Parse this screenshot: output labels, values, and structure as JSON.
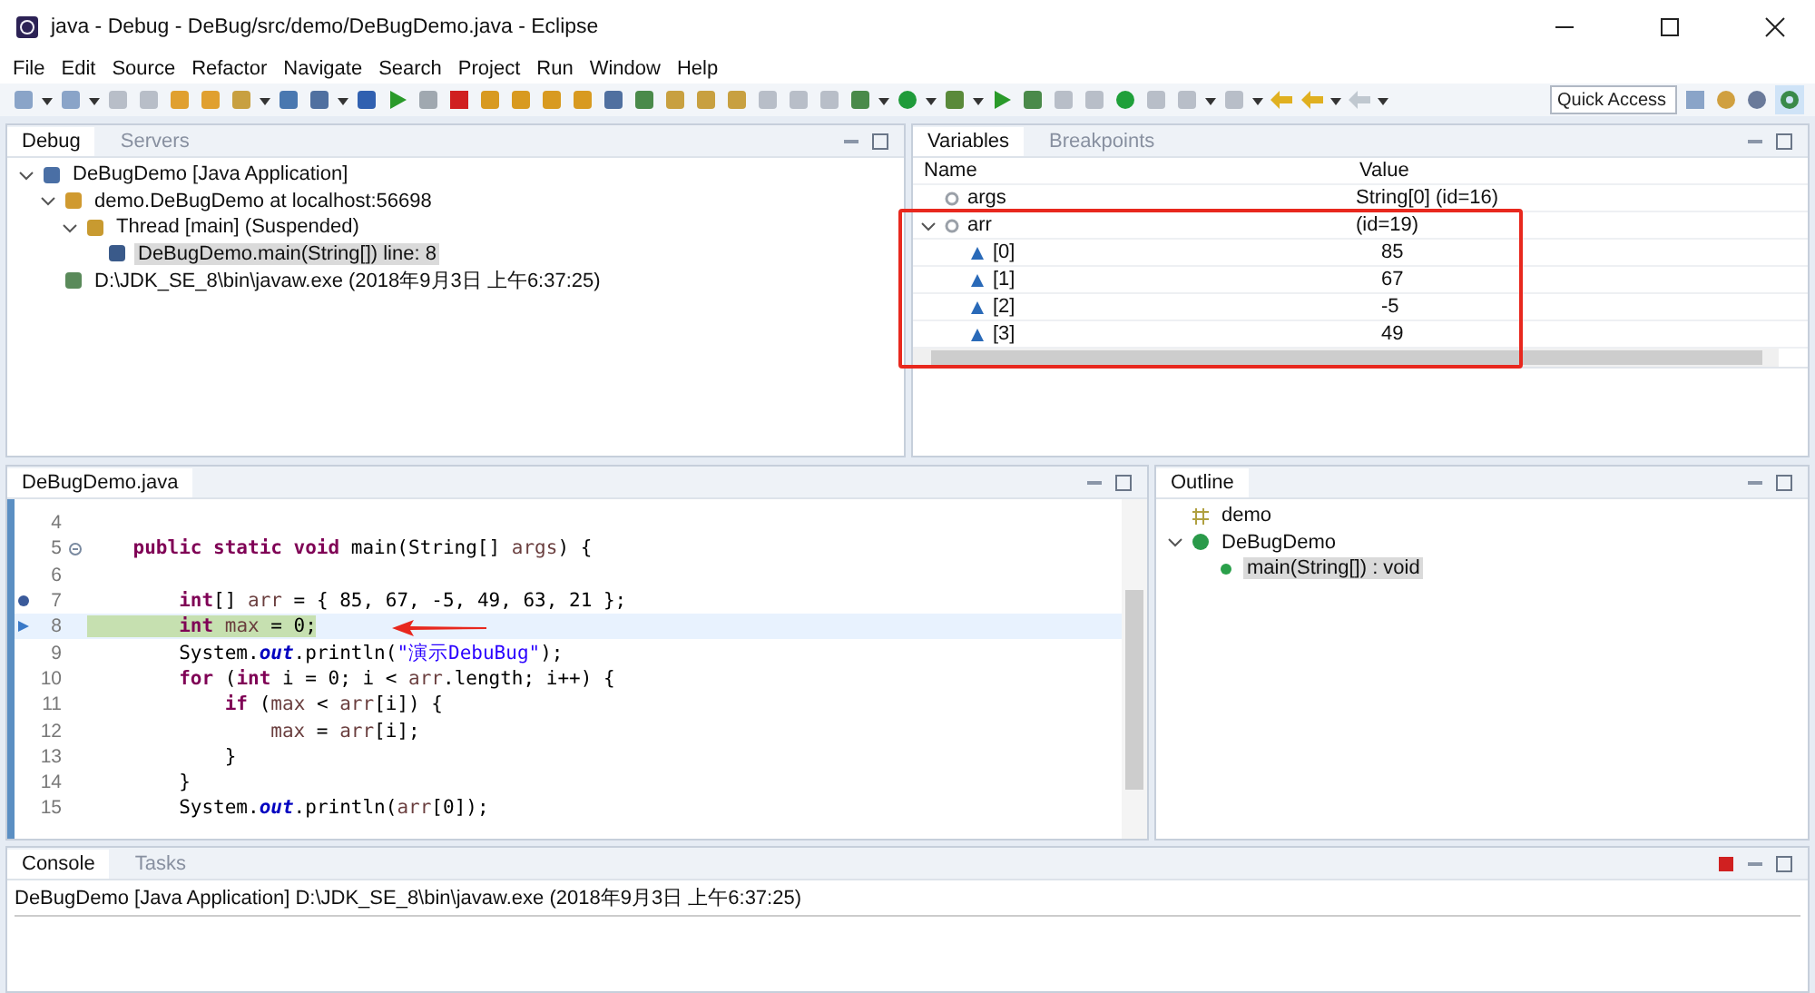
{
  "window": {
    "title": "java - Debug - DeBug/src/demo/DeBugDemo.java - Eclipse"
  },
  "menu": [
    "File",
    "Edit",
    "Source",
    "Refactor",
    "Navigate",
    "Search",
    "Project",
    "Run",
    "Window",
    "Help"
  ],
  "quick_access": {
    "placeholder": "Quick Access"
  },
  "debug_panel": {
    "tabs": [
      {
        "label": "Debug",
        "selected": true
      },
      {
        "label": "Servers",
        "selected": false
      }
    ],
    "tree": [
      {
        "label": "DeBugDemo [Java Application]",
        "kind": "launch",
        "expanded": true,
        "selected": false,
        "children": [
          {
            "label": "demo.DeBugDemo at localhost:56698",
            "kind": "target",
            "expanded": true,
            "selected": false,
            "children": [
              {
                "label": "Thread [main] (Suspended)",
                "kind": "thread",
                "expanded": true,
                "selected": false,
                "children": [
                  {
                    "label": "DeBugDemo.main(String[]) line: 8",
                    "kind": "frame",
                    "selected": true
                  }
                ]
              }
            ]
          },
          {
            "label": "D:\\JDK_SE_8\\bin\\javaw.exe (2018年9月3日 上午6:37:25)",
            "kind": "process",
            "selected": false
          }
        ]
      }
    ]
  },
  "variables_panel": {
    "tabs": [
      {
        "label": "Variables",
        "selected": true
      },
      {
        "label": "Breakpoints",
        "selected": false
      }
    ],
    "columns": [
      "Name",
      "Value"
    ],
    "rows": [
      {
        "name": "args",
        "value": "String[0]  (id=16)",
        "kind": "local"
      },
      {
        "name": "arr",
        "value": "(id=19)",
        "kind": "local",
        "expanded": true,
        "children": [
          {
            "name": "[0]",
            "value": "85",
            "kind": "element"
          },
          {
            "name": "[1]",
            "value": "67",
            "kind": "element"
          },
          {
            "name": "[2]",
            "value": "-5",
            "kind": "element"
          },
          {
            "name": "[3]",
            "value": "49",
            "kind": "element"
          }
        ]
      }
    ]
  },
  "editor": {
    "tabs": [
      {
        "label": "DeBugDemo.java",
        "selected": true
      }
    ],
    "lines": [
      {
        "number": "4",
        "current": false
      },
      {
        "number": "5",
        "current": false,
        "marker": {
          "kind": "fold"
        },
        "tokens": [
          {
            "kind": "kw",
            "text": "    public static void"
          },
          {
            "kind": "plain",
            "text": " main(String[] "
          },
          {
            "kind": "var",
            "text": "args"
          },
          {
            "kind": "plain",
            "text": ") {"
          }
        ]
      },
      {
        "number": "6",
        "current": false
      },
      {
        "number": "7",
        "current": false,
        "marker": {
          "kind": "breakpoint"
        },
        "tokens": [
          {
            "kind": "kw",
            "text": "        int"
          },
          {
            "kind": "plain",
            "text": "[] "
          },
          {
            "kind": "var",
            "text": "arr"
          },
          {
            "kind": "plain",
            "text": " = { 85, 67, -5, 49, 63, 21 };"
          }
        ]
      },
      {
        "number": "8",
        "current": true,
        "marker": {
          "kind": "current"
        },
        "tokens": [
          {
            "kind": "kw",
            "text": "        int"
          },
          {
            "kind": "var",
            "text": " max"
          },
          {
            "kind": "plain",
            "text": " = 0;"
          }
        ]
      },
      {
        "number": "9",
        "current": false,
        "tokens": [
          {
            "kind": "plain",
            "text": "        System."
          },
          {
            "kind": "field",
            "text": "out"
          },
          {
            "kind": "plain",
            "text": ".println("
          },
          {
            "kind": "str",
            "text": "\"演示DebuBug\""
          },
          {
            "kind": "plain",
            "text": ");"
          }
        ]
      },
      {
        "number": "10",
        "current": false,
        "tokens": [
          {
            "kind": "kw",
            "text": "        for"
          },
          {
            "kind": "plain",
            "text": " ("
          },
          {
            "kind": "kw",
            "text": "int"
          },
          {
            "kind": "plain",
            "text": " i = 0; i < "
          },
          {
            "kind": "var",
            "text": "arr"
          },
          {
            "kind": "plain",
            "text": ".length; i++) {"
          }
        ]
      },
      {
        "number": "11",
        "current": false,
        "tokens": [
          {
            "kind": "kw",
            "text": "            if"
          },
          {
            "kind": "plain",
            "text": " ("
          },
          {
            "kind": "var",
            "text": "max"
          },
          {
            "kind": "plain",
            "text": " < "
          },
          {
            "kind": "var",
            "text": "arr"
          },
          {
            "kind": "plain",
            "text": "[i]) {"
          }
        ]
      },
      {
        "number": "12",
        "current": false,
        "tokens": [
          {
            "kind": "var",
            "text": "                max"
          },
          {
            "kind": "plain",
            "text": " = "
          },
          {
            "kind": "var",
            "text": "arr"
          },
          {
            "kind": "plain",
            "text": "[i];"
          }
        ]
      },
      {
        "number": "13",
        "current": false,
        "tokens": [
          {
            "kind": "plain",
            "text": "            }"
          }
        ]
      },
      {
        "number": "14",
        "current": false,
        "tokens": [
          {
            "kind": "plain",
            "text": "        }"
          }
        ]
      },
      {
        "number": "15",
        "current": false,
        "tokens": [
          {
            "kind": "plain",
            "text": "        System."
          },
          {
            "kind": "field",
            "text": "out"
          },
          {
            "kind": "plain",
            "text": ".println("
          },
          {
            "kind": "var",
            "text": "arr"
          },
          {
            "kind": "plain",
            "text": "[0]);"
          }
        ]
      }
    ]
  },
  "outline_panel": {
    "tabs": [
      {
        "label": "Outline",
        "selected": true
      }
    ],
    "tree": [
      {
        "label": "demo",
        "kind": "package",
        "selected": false
      },
      {
        "label": "DeBugDemo",
        "kind": "class",
        "expanded": true,
        "selected": false,
        "children": [
          {
            "label": "main(String[]) : void",
            "kind": "method",
            "selected": true
          }
        ]
      }
    ]
  },
  "console_panel": {
    "tabs": [
      {
        "label": "Console",
        "selected": true
      },
      {
        "label": "Tasks",
        "selected": false
      }
    ],
    "header": "DeBugDemo [Java Application] D:\\JDK_SE_8\\bin\\javaw.exe (2018年9月3日 上午6:37:25)"
  }
}
